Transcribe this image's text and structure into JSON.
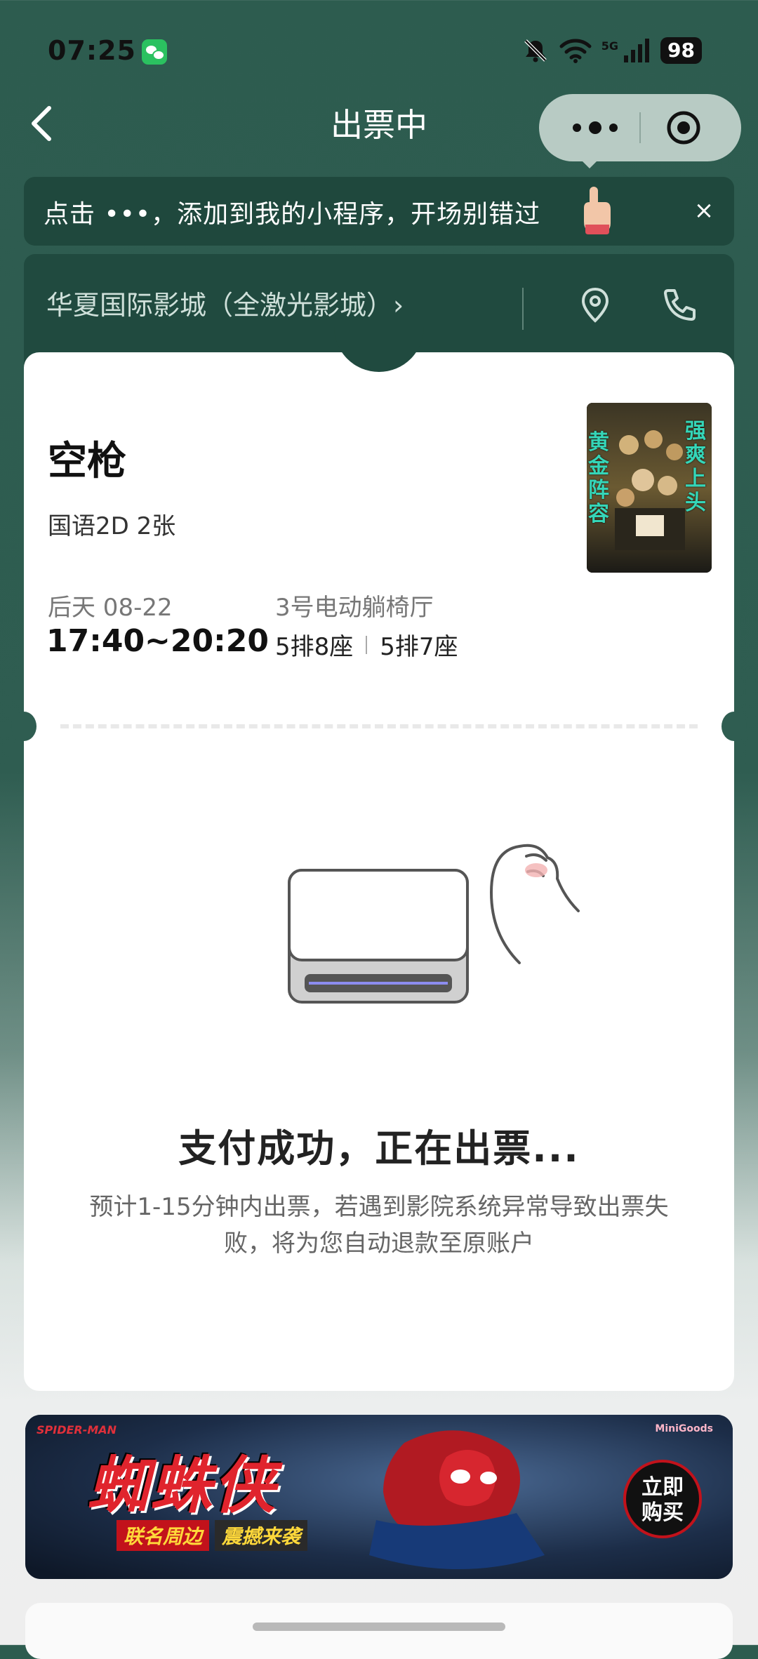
{
  "status_bar": {
    "time": "07:25",
    "network": "5G",
    "battery": "98"
  },
  "nav": {
    "title": "出票中"
  },
  "hint": {
    "text": "点击 •••，添加到我的小程序，开场别错过",
    "close": "×"
  },
  "cinema": {
    "name": "华夏国际影城（全激光影城）›"
  },
  "ticket": {
    "movie_title": "空枪",
    "meta": "国语2D 2张",
    "date": "后天 08-22",
    "time": "17:40~20:20",
    "hall": "3号电动躺椅厅",
    "seats": [
      "5排8座",
      "5排7座"
    ]
  },
  "poster": {
    "text_left": "黄金阵容",
    "text_right": "强爽上头"
  },
  "status": {
    "title": "支付成功，正在出票...",
    "description": "预计1-15分钟内出票，若遇到影院系统异常导致出票失败，将为您自动退款至原账户"
  },
  "ad": {
    "title": "蜘蛛侠",
    "subtitle_left": "联名周边",
    "subtitle_right": "震撼来袭",
    "button_line1": "立即",
    "button_line2": "购买",
    "logo_left": "SPIDER-MAN",
    "logo_right": "MiniGoods"
  },
  "colors": {
    "header_green": "#2d5c4f",
    "banner_green": "#1f483d",
    "cta_red": "#c2121b"
  }
}
